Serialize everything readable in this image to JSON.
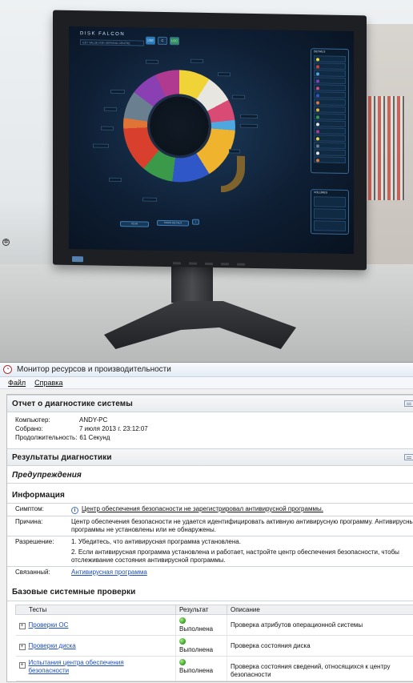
{
  "photo": {
    "monitor_app": {
      "title": "DISK FALCON",
      "subtitle": "GET VALUE FOR SERVING CENTRE",
      "mode_buttons": [
        "USE",
        "C",
        "LOC"
      ],
      "action_buttons": [
        "SCAN",
        "SHOW DETAILS",
        "i"
      ],
      "panel_titles": [
        "DETAILS",
        "VOLUMES"
      ],
      "segment_colors": [
        "#f0d437",
        "#e8e6e0",
        "#d94a74",
        "#4fa7df",
        "#f0b32e",
        "#2f57c7",
        "#3a9a4a",
        "#d8402d",
        "#e07436",
        "#6a8090",
        "#8a3fb2",
        "#b03a8f"
      ]
    }
  },
  "window": {
    "title": "Монитор ресурсов и производительности",
    "menu": [
      "Файл",
      "Справка"
    ]
  },
  "report": {
    "heading": "Отчет о диагностике системы",
    "fields": [
      {
        "label": "Компьютер:",
        "value": "ANDY-PC"
      },
      {
        "label": "Собрано:",
        "value": "7 июля 2013 г. 23:12:07"
      },
      {
        "label": "Продолжительность:",
        "value": "61 Секунд"
      }
    ]
  },
  "results": {
    "heading": "Результаты диагностики",
    "warnings_heading": "Предупреждения",
    "info_heading": "Информация",
    "symptom_label": "Симптом:",
    "symptom_value": "Центр обеспечения безопасности не зарегистрировал антивирусной программы.",
    "cause_label": "Причина:",
    "cause_value": "Центр обеспечения безопасности не удается идентифицировать активную антивирусную программу. Антивирусные программы не установлены или не обнаружены.",
    "resolution_label": "Разрешение:",
    "resolution_1": "1. Убедитесь, что антивирусная программа установлена.",
    "resolution_2": "2. Если антивирусная программа установлена и работает, настройте центр обеспечения безопасности, чтобы отслеживание состояния антивирусной программы.",
    "related_label": "Связанный:",
    "related_value": "Антивирусная программа"
  },
  "basic_checks": {
    "heading": "Базовые системные проверки",
    "columns": [
      "Тесты",
      "Результат",
      "Описание"
    ],
    "rows": [
      {
        "test": "Проверки ОС",
        "result": "Выполнена",
        "description": "Проверка атрибутов операционной системы"
      },
      {
        "test": "Проверки диска",
        "result": "Выполнена",
        "description": "Проверка состояния диска"
      },
      {
        "test": "Испытания центра обеспечения безопасности",
        "result": "Выполнена",
        "description": "Проверка состояния сведений, относящихся к центру безопасности"
      }
    ]
  },
  "colors": {
    "link": "#1c4fb8",
    "ok": "#2f9a1e"
  }
}
